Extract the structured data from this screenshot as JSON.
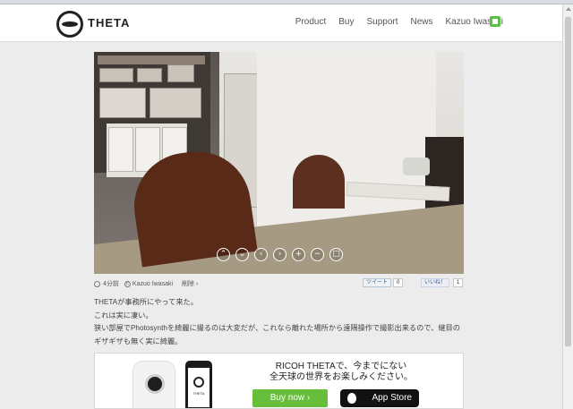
{
  "header": {
    "brand": "THETA",
    "nav": [
      "Product",
      "Buy",
      "Support",
      "News",
      "Kazuo Iwasaki"
    ]
  },
  "viewer": {
    "controls": [
      "rotate-up",
      "rotate-down",
      "rotate-left",
      "rotate-right",
      "zoom-in",
      "zoom-out",
      "fullscreen"
    ]
  },
  "meta": {
    "time": "4分前",
    "author": "Kazuo Iwasaki",
    "delete": "削除 ›"
  },
  "social": {
    "tweet_label": "ツイート",
    "tweet_count": "0",
    "like_label": "いいね！",
    "like_count": "1"
  },
  "article": {
    "lines": [
      "THETAが事務所にやって来た。",
      "これは実に凄い。",
      "狭い部屋でPhotosynthを綺麗に撮るのは大変だが、これなら離れた場所から遠隔操作で撮影出来るので、継目のギザギザも無く実に綺麗。"
    ]
  },
  "promo": {
    "title_line1": "RICOH THETAで、今までにない",
    "title_line2": "全天球の世界をお楽しみください。",
    "phone_text": "THETA",
    "buy_label": "Buy now ›",
    "appstore_label": "App Store"
  },
  "colors": {
    "accent": "#66be3a",
    "background": "#ececec"
  }
}
